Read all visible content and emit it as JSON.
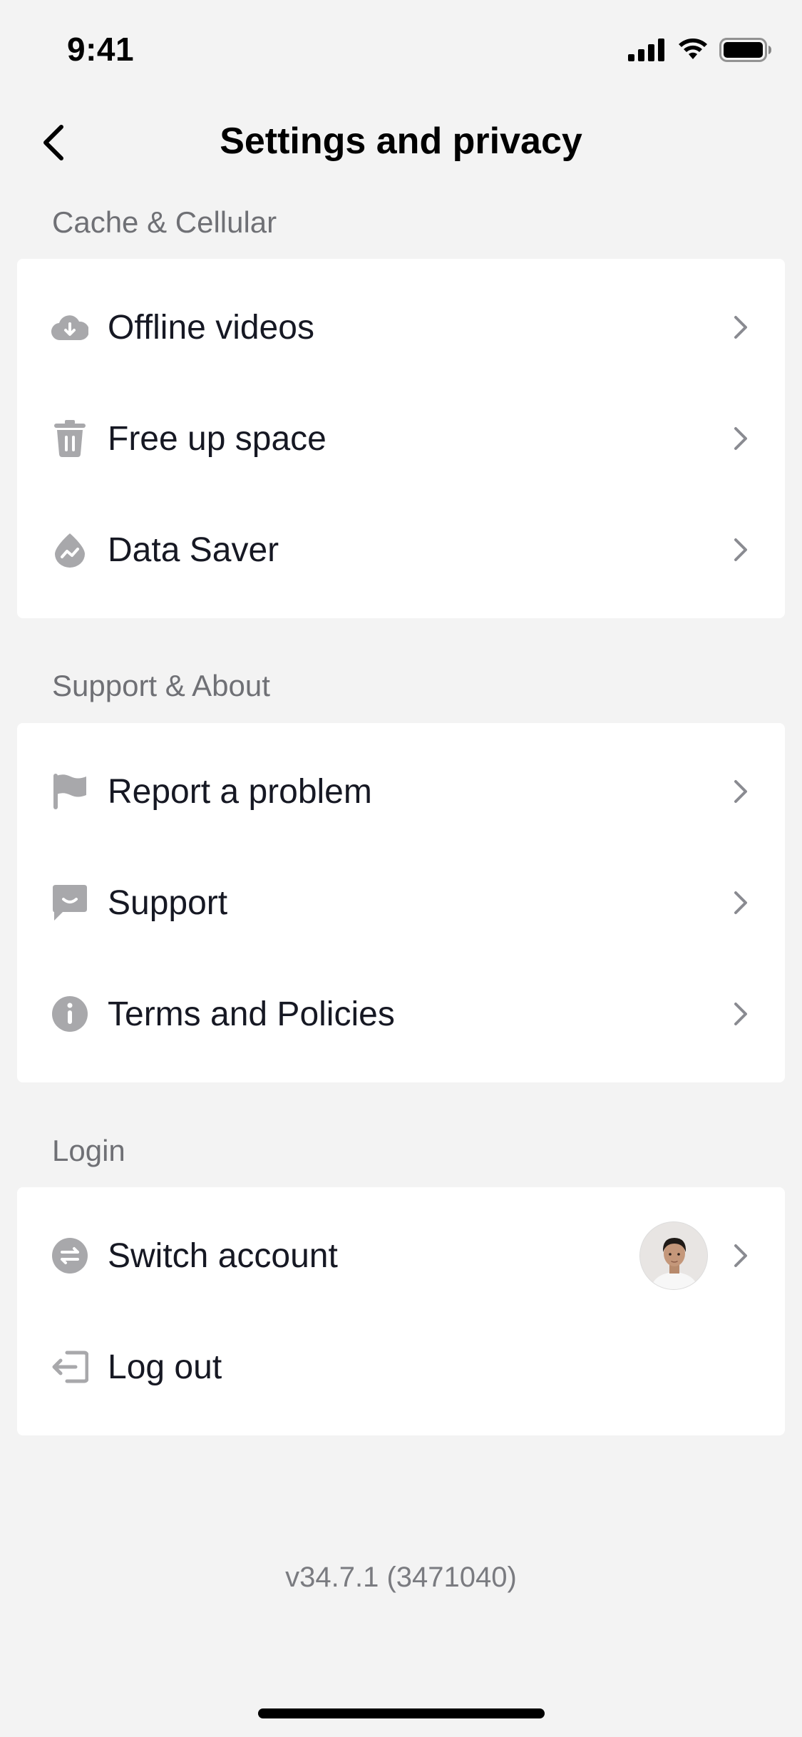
{
  "status_bar": {
    "time": "9:41"
  },
  "nav": {
    "title": "Settings and privacy"
  },
  "sections": [
    {
      "header": "Cache & Cellular",
      "items": [
        {
          "label": "Offline videos",
          "icon": "cloud-download-icon"
        },
        {
          "label": "Free up space",
          "icon": "trash-icon"
        },
        {
          "label": "Data Saver",
          "icon": "drop-icon"
        }
      ]
    },
    {
      "header": "Support & About",
      "items": [
        {
          "label": "Report a problem",
          "icon": "flag-icon"
        },
        {
          "label": "Support",
          "icon": "chat-icon"
        },
        {
          "label": "Terms and Policies",
          "icon": "info-icon"
        }
      ]
    },
    {
      "header": "Login",
      "items": [
        {
          "label": "Switch account",
          "icon": "switch-icon"
        },
        {
          "label": "Log out",
          "icon": "logout-icon"
        }
      ]
    }
  ],
  "version": "v34.7.1 (3471040)",
  "colors": {
    "background": "#f3f3f3",
    "card": "#ffffff",
    "icon_gray": "#a8a8ab",
    "chevron_gray": "#8a8b91",
    "text_primary": "#161823",
    "text_secondary": "#6f7075"
  }
}
